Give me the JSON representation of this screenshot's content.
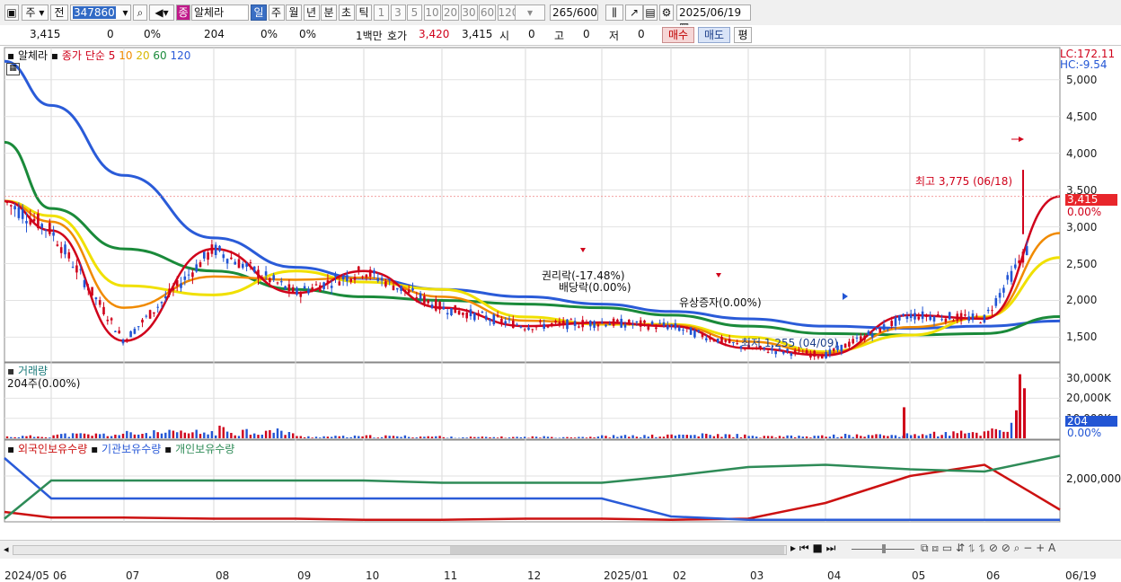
{
  "toolbar": {
    "market": "주",
    "prev": "전",
    "code": "347860",
    "stock_type": "종",
    "stock_name": "알체라",
    "periods": [
      "일",
      "주",
      "월",
      "년",
      "분",
      "초",
      "틱"
    ],
    "minute_steps": [
      "1",
      "3",
      "5",
      "10",
      "20",
      "30",
      "60",
      "120"
    ],
    "count_shown": "265",
    "count_total": "/600",
    "date": "2025/06/19"
  },
  "info": {
    "price": "3,415",
    "change": "0",
    "change_pct": "0%",
    "volume": "204",
    "vol_pct1": "0%",
    "vol_pct2": "0%",
    "unit": "1백만",
    "quote_label": "호가",
    "quote": "3,420",
    "open": "3,415",
    "open_label": "시",
    "open_val": "0",
    "high_label": "고",
    "high_val": "0",
    "low_label": "저",
    "low_val": "0",
    "buy": "매수",
    "sell": "매도",
    "eval": "평"
  },
  "legend": {
    "name": "알체라",
    "price_label": "종가",
    "ma_type": "단순",
    "ma5": "5",
    "ma10": "10",
    "ma20": "20",
    "ma60": "60",
    "ma120": "120",
    "lc": "LC:172.11",
    "hc": "HC:-9.54"
  },
  "annotations": {
    "high": "최고 3,775 (06/18)",
    "low": "최저 1,255 (04/09)",
    "rights": "권리락(-17.48%)",
    "dividend": "배당락(0.00%)",
    "capital": "유상증자(0.00%)"
  },
  "price_panel": {
    "current_price": "3,415",
    "current_pct": "0.00%",
    "y_ticks": [
      "5,000",
      "4,500",
      "4,000",
      "3,500",
      "3,000",
      "2,500",
      "2,000",
      "1,500"
    ]
  },
  "volume_panel": {
    "title": "거래량",
    "value": "204주(0.00%)",
    "y_ticks": [
      "30,000K",
      "20,000K",
      "10,000K"
    ],
    "current": "204",
    "current_pct": "0.00%"
  },
  "holdings_panel": {
    "foreign": "외국인보유수량",
    "institution": "기관보유수량",
    "individual": "개인보유수량",
    "y_ticks": [
      "2,000,000"
    ]
  },
  "x_ticks": [
    "2024/05",
    "06",
    "07",
    "08",
    "09",
    "10",
    "11",
    "12",
    "2025/01",
    "02",
    "03",
    "04",
    "05",
    "06",
    "06/19"
  ],
  "colors": {
    "up": "#d0021b",
    "down": "#2255d4",
    "ma5": "#d0021b",
    "ma10": "#f08a00",
    "ma20": "#f0e000",
    "ma60": "#1a8a3a",
    "ma120": "#2a5bd8",
    "foreign": "#cc1111",
    "institution": "#2a5bd8",
    "individual": "#2e8b57"
  },
  "chart_data": [
    {
      "type": "line",
      "title": "알체라",
      "xlabel": "",
      "ylabel": "",
      "x": [
        "2024/05",
        "06",
        "07",
        "08",
        "09",
        "10",
        "11",
        "12",
        "2025/01",
        "02",
        "03",
        "04",
        "05",
        "06",
        "06/19"
      ],
      "ylim": [
        1200,
        5400
      ],
      "series": [
        {
          "name": "종가",
          "values": [
            3350,
            2950,
            1450,
            2700,
            2100,
            2400,
            1900,
            1650,
            1700,
            1650,
            1350,
            1255,
            1800,
            1750,
            3415
          ]
        },
        {
          "name": "120",
          "values": [
            5250,
            4650,
            3700,
            2850,
            2450,
            2300,
            2150,
            2050,
            1950,
            1850,
            1750,
            1650,
            1620,
            1650,
            1720
          ]
        },
        {
          "name": "60",
          "values": [
            4150,
            3250,
            2700,
            2400,
            2150,
            2050,
            2000,
            1950,
            1900,
            1800,
            1650,
            1550,
            1530,
            1550,
            1780
          ]
        }
      ]
    },
    {
      "type": "bar",
      "title": "거래량",
      "ylabel": "",
      "x": [
        "2024/05",
        "06",
        "07",
        "08",
        "09",
        "10",
        "11",
        "12",
        "2025/01",
        "02",
        "03",
        "04",
        "05",
        "06",
        "06/19"
      ],
      "ylim": [
        0,
        35000
      ],
      "values": [
        1200,
        2500,
        3500,
        6000,
        1200,
        1500,
        800,
        1000,
        1500,
        2500,
        1200,
        2000,
        3000,
        6000,
        32000
      ],
      "unit": "K"
    },
    {
      "type": "line",
      "title": "",
      "x": [
        "2024/05",
        "06",
        "07",
        "08",
        "09",
        "10",
        "11",
        "12",
        "2025/01",
        "02",
        "03",
        "04",
        "05",
        "06",
        "06/19"
      ],
      "ylim": [
        0,
        3200000
      ],
      "series": [
        {
          "name": "외국인보유수량",
          "values": [
            400000,
            150000,
            150000,
            100000,
            100000,
            50000,
            50000,
            100000,
            100000,
            50000,
            100000,
            800000,
            2000000,
            2500000,
            500000
          ]
        },
        {
          "name": "기관보유수량",
          "values": [
            2800000,
            1000000,
            1000000,
            1000000,
            1000000,
            1000000,
            1000000,
            1000000,
            1000000,
            200000,
            50000,
            50000,
            50000,
            50000,
            50000
          ]
        },
        {
          "name": "개인보유수량",
          "values": [
            100000,
            1800000,
            1800000,
            1800000,
            1800000,
            1800000,
            1700000,
            1700000,
            1700000,
            2000000,
            2400000,
            2500000,
            2300000,
            2200000,
            2900000
          ]
        }
      ]
    }
  ]
}
